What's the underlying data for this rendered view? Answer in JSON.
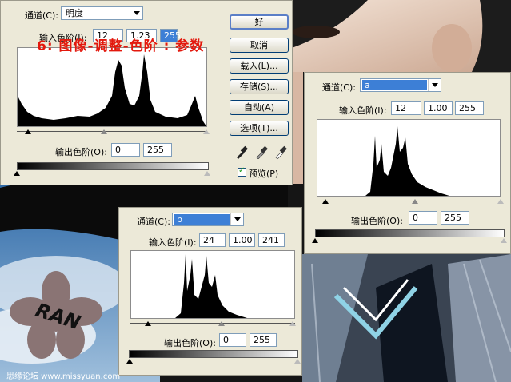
{
  "main_dialog": {
    "channel_label": "通道(C):",
    "channel_value": "明度",
    "input_label": "输入色阶(I):",
    "input_values": [
      "12",
      "1.23",
      "255"
    ],
    "output_label": "输出色阶(O):",
    "output_values": [
      "0",
      "255"
    ],
    "buttons": [
      "好",
      "取消",
      "载入(L)...",
      "存储(S)...",
      "自动(A)",
      "选项(T)..."
    ],
    "preview_label": "预览(P)",
    "preview_checked": true
  },
  "overlay_caption": "6: 图像-调整-色阶 : 参数",
  "dialog_a": {
    "channel_label": "通道(C):",
    "channel_value": "a",
    "input_label": "输入色阶(I):",
    "input_values": [
      "12",
      "1.00",
      "255"
    ],
    "output_label": "输出色阶(O):",
    "output_values": [
      "0",
      "255"
    ]
  },
  "dialog_b": {
    "channel_label": "通道(C):",
    "channel_value": "b",
    "input_label": "输入色阶(I):",
    "input_values": [
      "24",
      "1.00",
      "241"
    ],
    "output_label": "输出色阶(O):",
    "output_values": [
      "0",
      "255"
    ]
  },
  "logo_text": "RAN",
  "watermark": "思缘论坛 www.missyuan.com",
  "colors": {
    "dialog_bg": "#ece9d8",
    "selection": "#3d7fd6",
    "caption": "#e3180d",
    "sky": "#5b8fc4"
  }
}
